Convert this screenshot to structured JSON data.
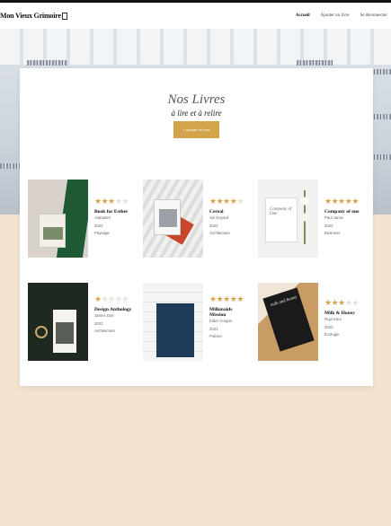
{
  "header": {
    "brand": "Mon Vieux Grimoire",
    "nav": [
      "Accueil",
      "Ajouter un livre",
      "Se déconnecter"
    ]
  },
  "main": {
    "title": "Nos Livres",
    "subtitle": "à lire et à relire",
    "add_button": "+ Ajouter un livre"
  },
  "colors": {
    "accent": "#d4a44d",
    "background": "#f2e4cf"
  },
  "books": [
    {
      "title": "Book for Esther",
      "author": "Alabaster",
      "year": "2022",
      "genre": "Paysage",
      "rating": 3
    },
    {
      "title": "Cereal",
      "author": "Val Goyard",
      "year": "2022",
      "genre": "Architecture",
      "rating": 4
    },
    {
      "title": "Company of one",
      "author": "Paul Jarvis",
      "year": "2022",
      "genre": "Business",
      "rating": 5
    },
    {
      "title": "Design Anthology",
      "author": "James Doe",
      "year": "2022",
      "genre": "Architecture",
      "rating": 1
    },
    {
      "title": "Milkmaids Mission",
      "author": "Elder Cooper",
      "year": "2021",
      "genre": "Policier",
      "rating": 5
    },
    {
      "title": "Milk & Honey",
      "author": "Rupi Kaur",
      "year": "2022",
      "genre": "Écologie",
      "rating": 3
    }
  ],
  "cover_text": {
    "cereal": "CEREAL",
    "company": "Company of One",
    "milk": "milk and honey"
  }
}
